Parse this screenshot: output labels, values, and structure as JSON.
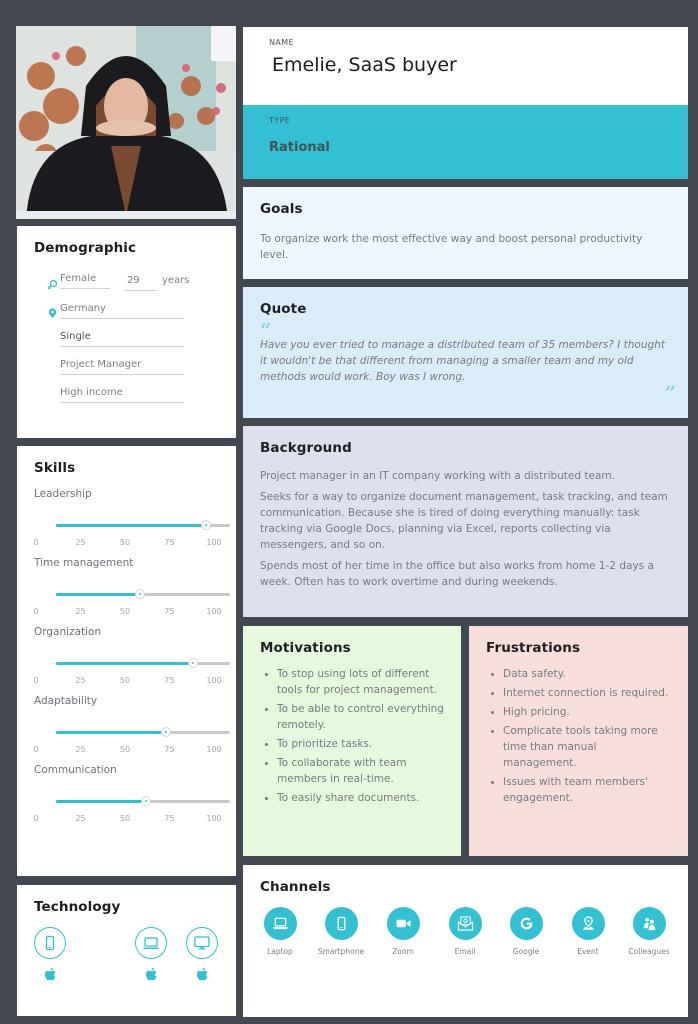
{
  "persona": {
    "name_label": "NAME",
    "name": "Emelie, SaaS buyer",
    "type_label": "TYPE",
    "type": "Rational",
    "photo_alt": "Young woman in black hoodie with hands folded in front of face"
  },
  "demographic": {
    "title": "Demographic",
    "gender": "Female",
    "age": "29",
    "age_unit": "years",
    "location": "Germany",
    "relationship": "Single",
    "job": "Project Manager",
    "income": "High income"
  },
  "skills": {
    "title": "Skills",
    "scale_ticks": [
      "0",
      "25",
      "50",
      "75",
      "100"
    ],
    "items": [
      {
        "name": "Leadership",
        "value": 86
      },
      {
        "name": "Time management",
        "value": 48
      },
      {
        "name": "Organization",
        "value": 79
      },
      {
        "name": "Adaptability",
        "value": 63
      },
      {
        "name": "Communication",
        "value": 52
      }
    ]
  },
  "technology": {
    "title": "Technology",
    "devices": [
      {
        "icon": "smartphone-icon",
        "os": "apple-icon"
      },
      {
        "icon": "laptop-icon",
        "os": "apple-icon"
      },
      {
        "icon": "desktop-icon",
        "os": "apple-icon"
      }
    ]
  },
  "goals": {
    "title": "Goals",
    "text": "To organize work the most effective way and boost personal productivity level."
  },
  "quote": {
    "title": "Quote",
    "open_mark": "“",
    "close_mark": "”",
    "text": "Have you ever tried to manage a distributed team of 35 members? I thought it wouldn't be that different from managing a smaller team and my old methods would work. Boy was I wrong."
  },
  "background": {
    "title": "Background",
    "paragraphs": [
      "Project manager in an IT company working with a distributed team.",
      "Seeks for a way to organize document management, task tracking, and team communication. Because she is tired of doing everything manually: task tracking via Google Docs, planning via Excel, reports collecting via messengers, and so on.",
      "Spends most of her time in the office but also works from home 1-2 days a week. Often has to work overtime and during weekends."
    ]
  },
  "motivations": {
    "title": "Motivations",
    "items": [
      "To stop using lots of different tools for project management.",
      "To be able to control everything remotely.",
      "To prioritize tasks.",
      "To collaborate with team members in real-time.",
      "To easily share documents."
    ]
  },
  "frustrations": {
    "title": "Frustrations",
    "items": [
      "Data safety.",
      "Internet connection is required.",
      "High pricing.",
      "Complicate tools taking more time than manual management.",
      "Issues with team members' engagement."
    ]
  },
  "channels": {
    "title": "Channels",
    "items": [
      {
        "label": "Laptop",
        "icon": "laptop-icon"
      },
      {
        "label": "Smartphone",
        "icon": "smartphone-icon"
      },
      {
        "label": "Zoom",
        "icon": "video-camera-icon"
      },
      {
        "label": "Email",
        "icon": "email-icon"
      },
      {
        "label": "Google",
        "icon": "google-icon"
      },
      {
        "label": "Event",
        "icon": "event-location-icon"
      },
      {
        "label": "Colleagues",
        "icon": "colleagues-icon"
      }
    ]
  },
  "colors": {
    "accent": "#33c0d2",
    "page_background": "#434850",
    "goals_bg": "#eef6ff",
    "quote_bg": "#d9eefa",
    "background_bg": "#dde1ee",
    "motivations_bg": "#e7f9dd",
    "frustrations_bg": "#f8dfdb"
  }
}
